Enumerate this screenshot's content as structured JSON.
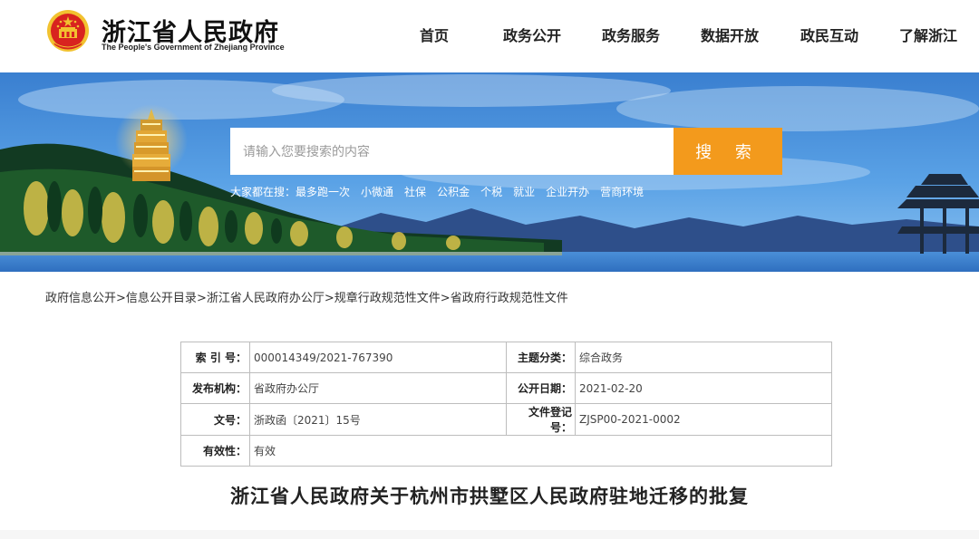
{
  "header": {
    "title": "浙江省人民政府",
    "subtitle": "The People's Government of Zhejiang Province",
    "emblem_icon": "national-emblem-icon",
    "nav": [
      {
        "label": "首页"
      },
      {
        "label": "政务公开"
      },
      {
        "label": "政务服务"
      },
      {
        "label": "数据开放"
      },
      {
        "label": "政民互动"
      },
      {
        "label": "了解浙江"
      }
    ]
  },
  "banner": {
    "search": {
      "placeholder": "请输入您要搜索的内容",
      "button_label": "搜 索"
    },
    "hot": {
      "label": "大家都在搜：",
      "items": [
        "最多跑一次",
        "小微通",
        "社保",
        "公积金",
        "个税",
        "就业",
        "企业开办",
        "营商环境"
      ]
    }
  },
  "breadcrumb": {
    "items": [
      "政府信息公开",
      "信息公开目录",
      "浙江省人民政府办公厅",
      "规章行政规范性文件",
      "省政府行政规范性文件"
    ],
    "separator": ">"
  },
  "info": {
    "index_label": "索 引 号：",
    "index_value": "000014349/2021-767390",
    "topic_label": "主题分类：",
    "topic_value": "综合政务",
    "issuer_label": "发布机构：",
    "issuer_value": "省政府办公厅",
    "date_label": "公开日期：",
    "date_value": "2021-02-20",
    "docno_label": "文号：",
    "docno_value": "浙政函〔2021〕15号",
    "regno_label": "文件登记号：",
    "regno_value": "ZJSP00-2021-0002",
    "validity_label": "有效性：",
    "validity_value": "有效"
  },
  "document": {
    "title": "浙江省人民政府关于杭州市拱墅区人民政府驻地迁移的批复"
  },
  "colors": {
    "accent": "#f39a1c",
    "emblem_red": "#d8231f",
    "emblem_gold": "#f2c230"
  }
}
